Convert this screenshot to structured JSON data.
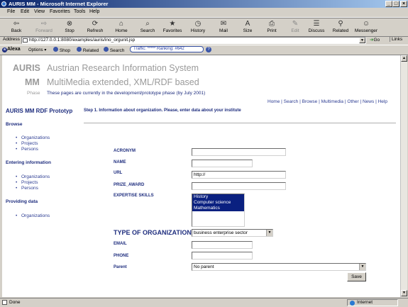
{
  "window": {
    "title": "AURIS MM - Microsoft Internet Explorer"
  },
  "menu": {
    "items": [
      "File",
      "Edit",
      "View",
      "Favorites",
      "Tools",
      "Help"
    ]
  },
  "toolbar": {
    "buttons": [
      {
        "label": "Back",
        "icon": "back-arrow-icon",
        "glyph": "⇦"
      },
      {
        "label": "Forward",
        "icon": "forward-arrow-icon",
        "glyph": "⇨"
      },
      {
        "label": "Stop",
        "icon": "stop-icon",
        "glyph": "⊗"
      },
      {
        "label": "Refresh",
        "icon": "refresh-icon",
        "glyph": "⟳"
      },
      {
        "label": "Home",
        "icon": "home-icon",
        "glyph": "⌂"
      },
      {
        "label": "Search",
        "icon": "search-icon",
        "glyph": "⌕"
      },
      {
        "label": "Favorites",
        "icon": "favorites-icon",
        "glyph": "★"
      },
      {
        "label": "History",
        "icon": "history-icon",
        "glyph": "◷"
      },
      {
        "label": "Mail",
        "icon": "mail-icon",
        "glyph": "✉"
      },
      {
        "label": "Size",
        "icon": "text-size-icon",
        "glyph": "A"
      },
      {
        "label": "Print",
        "icon": "print-icon",
        "glyph": "⎙"
      },
      {
        "label": "Edit",
        "icon": "edit-icon",
        "glyph": "✎"
      },
      {
        "label": "Discuss",
        "icon": "discuss-icon",
        "glyph": "☰"
      },
      {
        "label": "Related",
        "icon": "related-icon",
        "glyph": "⚲"
      },
      {
        "label": "Messenger",
        "icon": "messenger-icon",
        "glyph": "☺"
      }
    ]
  },
  "address": {
    "label": "Address",
    "url": "http://127.0.0.1:8080/examples/auris/ino_orgunit.jsp",
    "go": "Go",
    "links": "Links"
  },
  "alexa": {
    "brand": "Alexa",
    "options": "Options",
    "shop": "Shop",
    "related": "Related",
    "search": "Search",
    "rank": "Traffic: ***** Ranking: #642"
  },
  "header": {
    "line1_a": "AURIS",
    "line1_b": "Austrian Research Information System",
    "line2_a": "MM",
    "line2_b": "MultiMedia extended, XML/RDF based",
    "phase_label": "Phase",
    "phase_text": "These pages are currently in the development/prototype phase (by July 2001)"
  },
  "topnav": {
    "links": [
      "Home",
      "Search",
      "Browse",
      "Multimedia",
      "Other",
      "News",
      "Help"
    ],
    "sep": "|"
  },
  "sidebar": {
    "title": "AURIS MM RDF Prototyp",
    "browse_title": "Browse",
    "browse_items": [
      "Organizations",
      "Projects",
      "Persons"
    ],
    "entering_title": "Entering information",
    "entering_items": [
      "Organizations",
      "Projects",
      "Persons"
    ],
    "providing_title": "Providing data",
    "providing_items": [
      "Organizations"
    ]
  },
  "form": {
    "step_text": "Step 1. Information about organization. Please, enter data about your institute",
    "acronym_label": "ACRONYM",
    "acronym_value": "",
    "name_label": "NAME",
    "name_value": "",
    "url_label": "URL",
    "url_value": "http://",
    "prize_label": "PRIZE_AWARD",
    "prize_value": "",
    "expertise_label": "EXPERTISE SKILLS",
    "expertise_options": [
      "History",
      "Computer science",
      "Mathematics"
    ],
    "type_label": "TYPE OF ORGANIZATION",
    "type_value": "business enterprise sector",
    "email_label": "EMAIL",
    "email_value": "",
    "phone_label": "PHONE",
    "phone_value": "",
    "parent_label": "Parent",
    "parent_value": "No parent",
    "save_label": "Save"
  },
  "status": {
    "left": "Done",
    "zone": "Internet"
  },
  "colors": {
    "navy": "#1e2d7e",
    "link": "#2c3c92",
    "header_gray": "#9a9a9a",
    "selection": "#0a2080",
    "titlebar": "#0a246a"
  }
}
